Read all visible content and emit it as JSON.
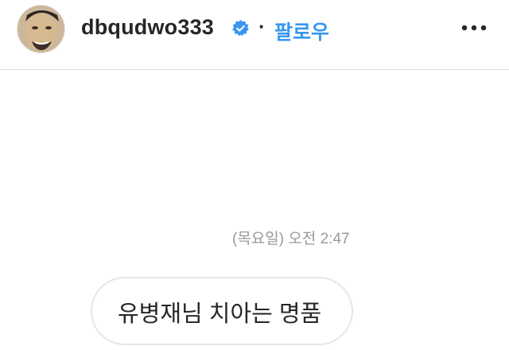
{
  "header": {
    "username": "dbqudwo333",
    "separator": "·",
    "follow_label": "팔로우",
    "verified_icon": "verified-badge-icon",
    "more_icon": "more-options-icon",
    "verified_color": "#3897f0",
    "follow_color": "#3897f0"
  },
  "conversation": {
    "timestamp": "(목요일) 오전 2:47",
    "messages": [
      {
        "text": "유병재님 치아는 명품"
      }
    ]
  }
}
